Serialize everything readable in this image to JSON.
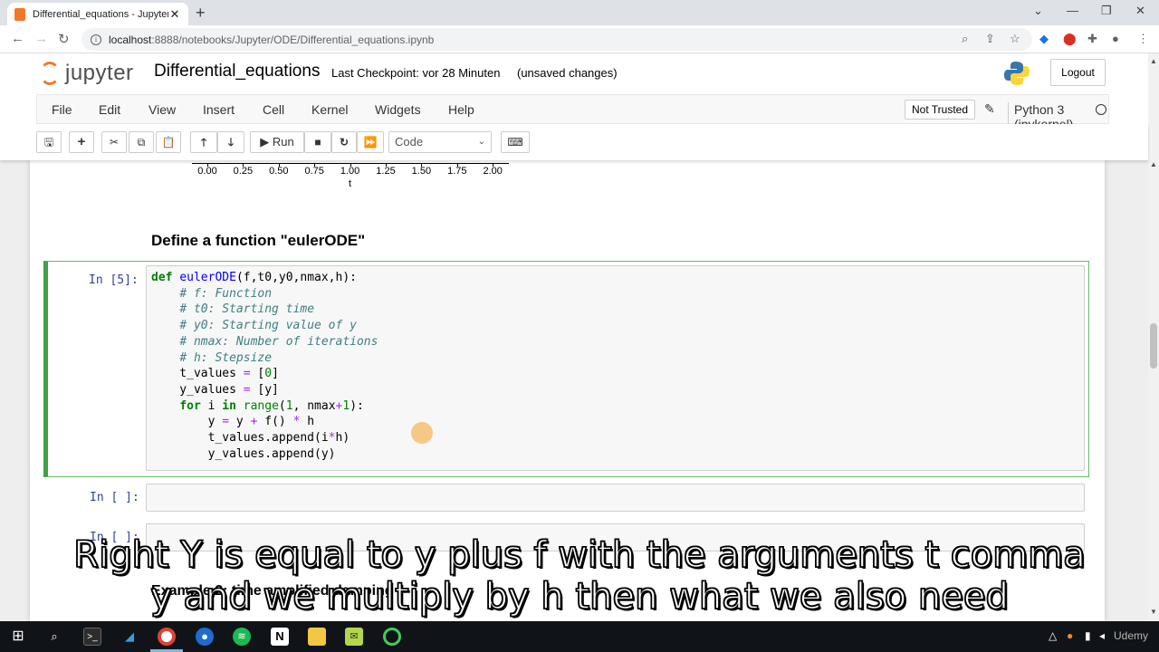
{
  "browser": {
    "tab_title": "Differential_equations - Jupyter N",
    "tab_close": "✕",
    "new_tab": "+",
    "url_host": "localhost",
    "url_rest": ":8888/notebooks/Jupyter/ODE/Differential_equations.ipynb",
    "window_controls": [
      "⌄",
      "—",
      "❐",
      "✕"
    ]
  },
  "jupyter": {
    "logo_text": "jupyter",
    "notebook_name": "Differential_equations",
    "checkpoint": "Last Checkpoint: vor 28 Minuten",
    "unsaved": "(unsaved changes)",
    "logout": "Logout",
    "menu": [
      "File",
      "Edit",
      "View",
      "Insert",
      "Cell",
      "Kernel",
      "Widgets",
      "Help"
    ],
    "trust": "Not Trusted",
    "kernel": "Python 3 (ipykernel)",
    "toolbar": {
      "run": "Run",
      "cell_type": "Code"
    }
  },
  "plot_axis": {
    "ticks": [
      "0.00",
      "0.25",
      "0.50",
      "0.75",
      "1.00",
      "1.25",
      "1.50",
      "1.75",
      "2.00"
    ],
    "xlabel": "t"
  },
  "markdown_heading": "Define a function \"eulerODE\"",
  "cells": {
    "cell5_prompt": "In [5]:",
    "empty1_prompt": "In [ ]:",
    "empty2_prompt": "In [ ]:",
    "bottom_heading": "Example 2: time amplified damping"
  },
  "subtitles": {
    "line1": "Right Y is equal to y plus f with the arguments t comma",
    "line2": "y and we multiply by h then what we also need"
  },
  "watermark": "Udemy"
}
